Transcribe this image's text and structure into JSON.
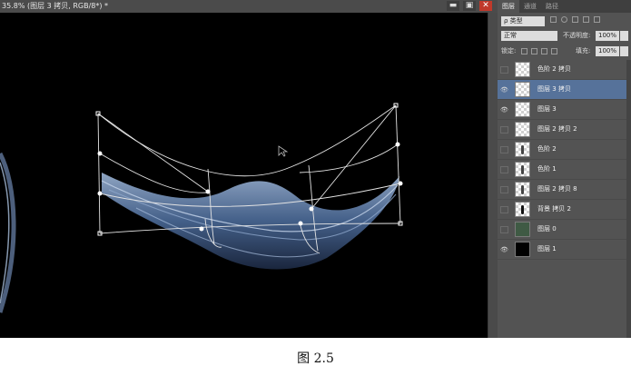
{
  "window": {
    "doc_title": "35.8% (图层 3 拷贝, RGB/8*) *",
    "buttons": [
      "▬",
      "▣",
      "✕"
    ]
  },
  "panel": {
    "tabs": [
      "图层",
      "通道",
      "路径"
    ],
    "filter_label": "ρ 类型",
    "blend_mode": "正常",
    "opacity_label": "不透明度:",
    "opacity_value": "100%",
    "lock_label": "锁定:",
    "fill_label": "填充:",
    "fill_value": "100%",
    "layers": [
      {
        "name": "色阶 2 拷贝",
        "visible": false,
        "thumb": "checker"
      },
      {
        "name": "图层 3 拷贝",
        "visible": true,
        "thumb": "checker",
        "selected": true
      },
      {
        "name": "图层 3",
        "visible": true,
        "thumb": "checker"
      },
      {
        "name": "图层 2 拷贝 2",
        "visible": false,
        "thumb": "checker"
      },
      {
        "name": "色阶 2",
        "visible": false,
        "thumb": "checker-mark"
      },
      {
        "name": "色阶 1",
        "visible": false,
        "thumb": "checker-mark"
      },
      {
        "name": "图层 2 拷贝 8",
        "visible": false,
        "thumb": "checker-mark"
      },
      {
        "name": "背景 拷贝 2",
        "visible": false,
        "thumb": "checker-mark"
      },
      {
        "name": "图层 0",
        "visible": false,
        "thumb": "photo"
      },
      {
        "name": "图层 1",
        "visible": true,
        "thumb": "black"
      }
    ]
  },
  "caption": "图 2.5"
}
